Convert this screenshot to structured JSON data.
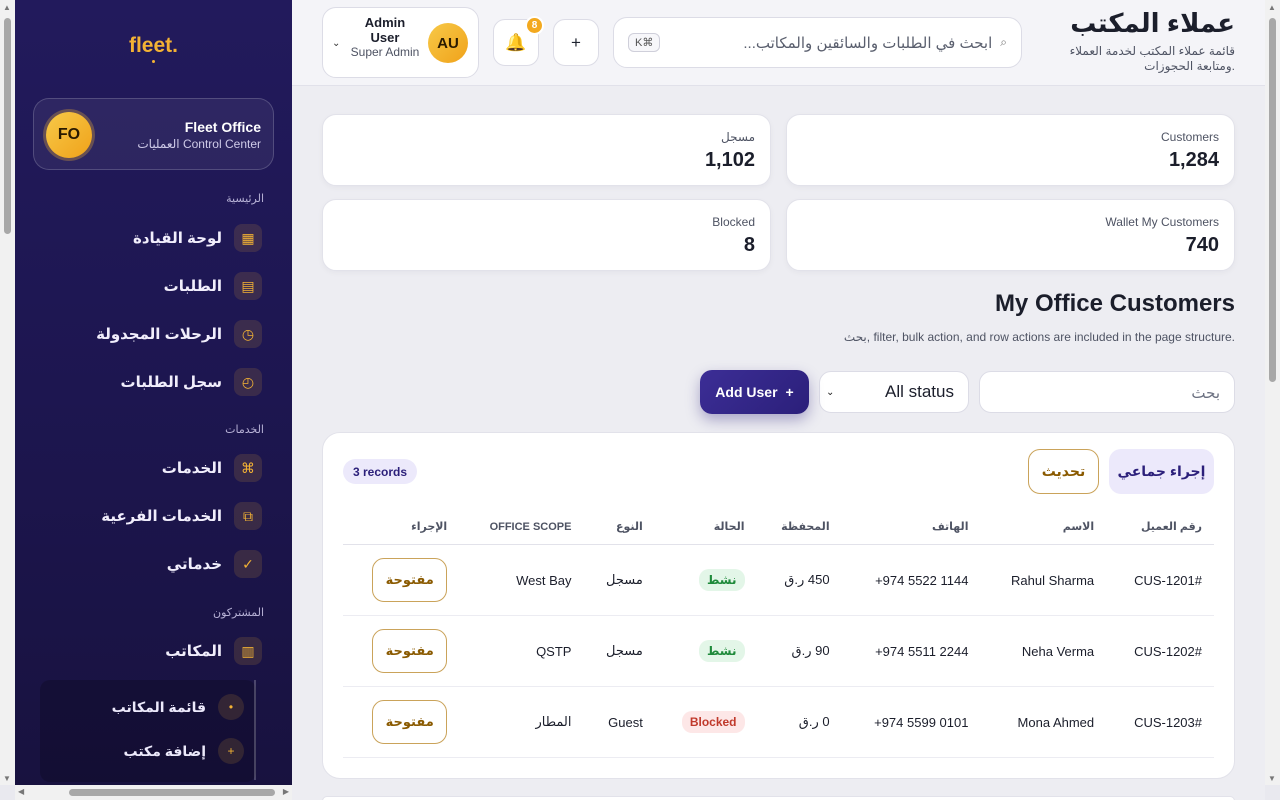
{
  "sidebar": {
    "logo": "fleet.",
    "brand": {
      "initials": "FO",
      "title": "Fleet Office",
      "subtitle": "العمليات Control Center"
    },
    "sections": {
      "main": "الرئيسية",
      "services": "الخدمات",
      "subscribers": "المشتركون"
    },
    "items": {
      "dashboard": "لوحة القيادة",
      "requests": "الطلبات",
      "scheduled": "الرحلات المجدولة",
      "log": "سجل الطلبات",
      "services": "الخدمات",
      "subservices": "الخدمات الفرعية",
      "myservices": "خدماتي",
      "offices": "المكاتب",
      "office_list": "قائمة المكاتب",
      "add_office": "إضافة مكتب"
    },
    "icons": {
      "dashboard": "grid-icon",
      "requests": "list-icon",
      "scheduled": "clock-icon",
      "log": "history-icon",
      "services": "command-icon",
      "subservices": "layers-icon",
      "myservices": "check-icon",
      "offices": "building-icon"
    }
  },
  "header": {
    "title": "عملاء المكتب",
    "description": "قائمة عملاء المكتب لخدمة العملاء ومتابعة الحجوزات.",
    "search_placeholder": "ابحث في الطلبات والسائقين والمكاتب...",
    "search_kbd": "K⌘",
    "plus_label": "+",
    "notification_count": "8",
    "user": {
      "initials": "AU",
      "name": "Admin User",
      "role": "Super Admin"
    }
  },
  "stats": [
    {
      "label": "Customers",
      "value": "1,284"
    },
    {
      "label": "مسجل",
      "value": "1,102"
    },
    {
      "label": "Wallet My Customers",
      "value": "740"
    },
    {
      "label": "Blocked",
      "value": "8"
    }
  ],
  "section": {
    "title": "My Office Customers",
    "description": "بحث, filter, bulk action, and row actions are included in the page structure."
  },
  "filters": {
    "search_placeholder": "بحث",
    "status_value": "All status",
    "add_user_label": "Add User",
    "add_user_plus": "+"
  },
  "table": {
    "bulk_label": "إجراء جماعي",
    "refresh_label": "تحديث",
    "records_label": "3 records",
    "headers": [
      "رقم العميل",
      "الاسم",
      "الهاتف",
      "المحفظة",
      "الحالة",
      "النوع",
      "OFFICE SCOPE",
      "الإجراء"
    ],
    "rows": [
      {
        "id": "#CUS-1201",
        "name": "Rahul Sharma",
        "phone": "+974 5522 1144",
        "wallet": "450 ر.ق",
        "status": "نشط",
        "status_kind": "active",
        "type": "مسجل",
        "scope": "West Bay",
        "action": "مفتوحة"
      },
      {
        "id": "#CUS-1202",
        "name": "Neha Verma",
        "phone": "+974 5511 2244",
        "wallet": "90 ر.ق",
        "status": "نشط",
        "status_kind": "active",
        "type": "مسجل",
        "scope": "QSTP",
        "action": "مفتوحة"
      },
      {
        "id": "#CUS-1203",
        "name": "Mona Ahmed",
        "phone": "+974 5599 0101",
        "wallet": "0 ر.ق",
        "status": "Blocked",
        "status_kind": "blocked",
        "type": "Guest",
        "scope": "المطار",
        "action": "مفتوحة"
      }
    ]
  },
  "colors": {
    "sidebar_bg": "#221a5c",
    "accent_gold": "#f3b234",
    "primary": "#2b1f7a",
    "active_green": "#1f8a3b",
    "blocked_red": "#c0392b"
  }
}
